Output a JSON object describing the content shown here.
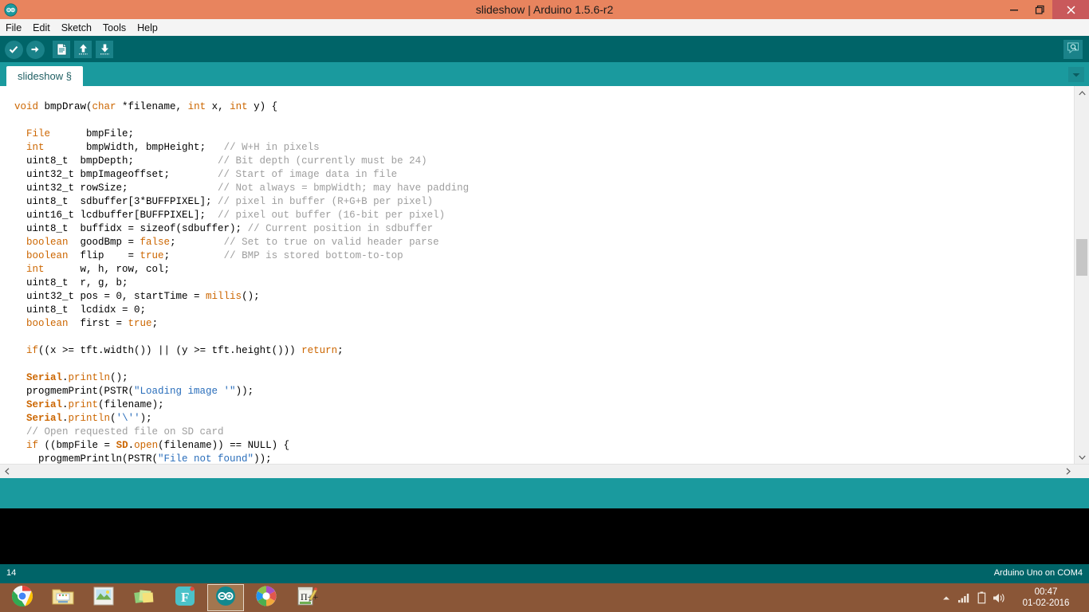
{
  "window": {
    "title": "slideshow | Arduino 1.5.6-r2",
    "logo_icon": "arduino-infinity-icon",
    "minimize_label": "–",
    "maximize_label": "❐",
    "close_label": "✕",
    "titlebar_color": "#E8845E",
    "close_color": "#C9595B"
  },
  "menubar": {
    "items": [
      {
        "label": "File"
      },
      {
        "label": "Edit"
      },
      {
        "label": "Sketch"
      },
      {
        "label": "Tools"
      },
      {
        "label": "Help"
      }
    ]
  },
  "toolbar": {
    "background": "#006468",
    "buttons": [
      {
        "name": "verify-button",
        "icon": "check-icon",
        "title": "Verify"
      },
      {
        "name": "upload-button",
        "icon": "arrow-right-icon",
        "title": "Upload"
      },
      {
        "name": "new-button",
        "icon": "new-file-icon",
        "title": "New"
      },
      {
        "name": "open-button",
        "icon": "arrow-up-icon",
        "title": "Open"
      },
      {
        "name": "save-button",
        "icon": "arrow-down-icon",
        "title": "Save"
      }
    ],
    "serial_monitor": {
      "name": "serial-monitor-button",
      "icon": "magnifier-bubble-icon",
      "title": "Serial Monitor"
    }
  },
  "tabbar": {
    "background": "#1A9A9E",
    "tabs": [
      {
        "label": "slideshow §",
        "active": true
      }
    ],
    "menu_icon": "chevron-down-icon"
  },
  "editor": {
    "lines": [
      [
        {
          "t": "void ",
          "c": "k"
        },
        {
          "t": "bmpDraw("
        },
        {
          "t": "char",
          "c": "k"
        },
        {
          "t": " *filename, "
        },
        {
          "t": "int",
          "c": "k"
        },
        {
          "t": " x, "
        },
        {
          "t": "int",
          "c": "k"
        },
        {
          "t": " y) {"
        }
      ],
      [
        {
          "t": ""
        }
      ],
      [
        {
          "t": "  "
        },
        {
          "t": "File",
          "c": "k"
        },
        {
          "t": "      bmpFile;"
        }
      ],
      [
        {
          "t": "  "
        },
        {
          "t": "int",
          "c": "k"
        },
        {
          "t": "       bmpWidth, bmpHeight;   "
        },
        {
          "t": "// W+H in pixels",
          "c": "c"
        }
      ],
      [
        {
          "t": "  uint8_t  bmpDepth;              "
        },
        {
          "t": "// Bit depth (currently must be 24)",
          "c": "c"
        }
      ],
      [
        {
          "t": "  uint32_t bmpImageoffset;        "
        },
        {
          "t": "// Start of image data in file",
          "c": "c"
        }
      ],
      [
        {
          "t": "  uint32_t rowSize;               "
        },
        {
          "t": "// Not always = bmpWidth; may have padding",
          "c": "c"
        }
      ],
      [
        {
          "t": "  uint8_t  sdbuffer[3*BUFFPIXEL]; "
        },
        {
          "t": "// pixel in buffer (R+G+B per pixel)",
          "c": "c"
        }
      ],
      [
        {
          "t": "  uint16_t lcdbuffer[BUFFPIXEL];  "
        },
        {
          "t": "// pixel out buffer (16-bit per pixel)",
          "c": "c"
        }
      ],
      [
        {
          "t": "  uint8_t  buffidx = sizeof(sdbuffer); "
        },
        {
          "t": "// Current position in sdbuffer",
          "c": "c"
        }
      ],
      [
        {
          "t": "  "
        },
        {
          "t": "boolean",
          "c": "k"
        },
        {
          "t": "  goodBmp = "
        },
        {
          "t": "false",
          "c": "k"
        },
        {
          "t": ";        "
        },
        {
          "t": "// Set to true on valid header parse",
          "c": "c"
        }
      ],
      [
        {
          "t": "  "
        },
        {
          "t": "boolean",
          "c": "k"
        },
        {
          "t": "  flip    = "
        },
        {
          "t": "true",
          "c": "k"
        },
        {
          "t": ";         "
        },
        {
          "t": "// BMP is stored bottom-to-top",
          "c": "c"
        }
      ],
      [
        {
          "t": "  "
        },
        {
          "t": "int",
          "c": "k"
        },
        {
          "t": "      w, h, row, col;"
        }
      ],
      [
        {
          "t": "  uint8_t  r, g, b;"
        }
      ],
      [
        {
          "t": "  uint32_t pos = 0, startTime = "
        },
        {
          "t": "millis",
          "c": "fn"
        },
        {
          "t": "();"
        }
      ],
      [
        {
          "t": "  uint8_t  lcdidx = 0;"
        }
      ],
      [
        {
          "t": "  "
        },
        {
          "t": "boolean",
          "c": "k"
        },
        {
          "t": "  first = "
        },
        {
          "t": "true",
          "c": "k"
        },
        {
          "t": ";"
        }
      ],
      [
        {
          "t": ""
        }
      ],
      [
        {
          "t": "  "
        },
        {
          "t": "if",
          "c": "k"
        },
        {
          "t": "((x >= tft.width()) || (y >= tft.height())) "
        },
        {
          "t": "return",
          "c": "k"
        },
        {
          "t": ";"
        }
      ],
      [
        {
          "t": ""
        }
      ],
      [
        {
          "t": "  "
        },
        {
          "t": "Serial",
          "c": "lib"
        },
        {
          "t": "."
        },
        {
          "t": "println",
          "c": "fn"
        },
        {
          "t": "();"
        }
      ],
      [
        {
          "t": "  progmemPrint(PSTR("
        },
        {
          "t": "\"Loading image '\"",
          "c": "s"
        },
        {
          "t": "));"
        }
      ],
      [
        {
          "t": "  "
        },
        {
          "t": "Serial",
          "c": "lib"
        },
        {
          "t": "."
        },
        {
          "t": "print",
          "c": "fn"
        },
        {
          "t": "(filename);"
        }
      ],
      [
        {
          "t": "  "
        },
        {
          "t": "Serial",
          "c": "lib"
        },
        {
          "t": "."
        },
        {
          "t": "println",
          "c": "fn"
        },
        {
          "t": "("
        },
        {
          "t": "'\\''",
          "c": "s"
        },
        {
          "t": ");"
        }
      ],
      [
        {
          "t": "  "
        },
        {
          "t": "// Open requested file on SD card",
          "c": "c"
        }
      ],
      [
        {
          "t": "  "
        },
        {
          "t": "if",
          "c": "k"
        },
        {
          "t": " ((bmpFile = "
        },
        {
          "t": "SD",
          "c": "lib"
        },
        {
          "t": "."
        },
        {
          "t": "open",
          "c": "fn"
        },
        {
          "t": "(filename)) == NULL) {"
        }
      ],
      [
        {
          "t": "    progmemPrintln(PSTR("
        },
        {
          "t": "\"File not found\"",
          "c": "s"
        },
        {
          "t": "));"
        }
      ]
    ],
    "vscroll": {
      "up_icon": "chevron-up-icon",
      "down_icon": "chevron-down-icon"
    },
    "hscroll": {
      "left_icon": "chevron-left-icon",
      "right_icon": "chevron-right-icon"
    }
  },
  "console": {
    "text": ""
  },
  "statusbar": {
    "line_number": "14",
    "board": "Arduino Uno on COM4",
    "background": "#006468"
  },
  "taskbar": {
    "background": "#8A5637",
    "items": [
      {
        "name": "taskbar-chrome",
        "icon": "chrome-icon",
        "active": false
      },
      {
        "name": "taskbar-file-explorer",
        "icon": "folder-icon",
        "active": false
      },
      {
        "name": "taskbar-photos",
        "icon": "photo-icon",
        "active": false
      },
      {
        "name": "taskbar-sticky-notes",
        "icon": "sticky-notes-icon",
        "active": false
      },
      {
        "name": "taskbar-f-app",
        "icon": "f-app-icon",
        "active": false
      },
      {
        "name": "taskbar-arduino",
        "icon": "arduino-infinity-icon",
        "active": true
      },
      {
        "name": "taskbar-picasa",
        "icon": "picasa-icon",
        "active": false
      },
      {
        "name": "taskbar-notepadpp",
        "icon": "notepad-pencil-icon",
        "active": false
      }
    ],
    "tray": {
      "show_hidden_icon": "chevron-up-icon",
      "network_icon": "signal-bars-icon",
      "battery_icon": "battery-icon",
      "volume_icon": "speaker-icon",
      "time": "00:47",
      "date": "01-02-2016"
    }
  }
}
